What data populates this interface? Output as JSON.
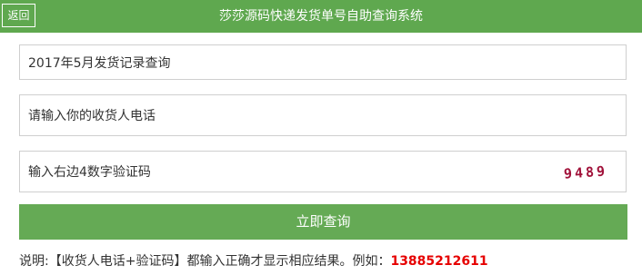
{
  "header": {
    "back_label": "返回",
    "title": "莎莎源码快递发货单号自助查询系统"
  },
  "form": {
    "query_period": "2017年5月发货记录查询",
    "phone_placeholder": "请输入你的收货人电话",
    "captcha_placeholder": "输入右边4数字验证码",
    "captcha_code": "9489",
    "submit_label": "立即查询"
  },
  "note": {
    "text": "说明:【收货人电话+验证码】都输入正确才显示相应结果。例如：",
    "example_phone": "13885212611"
  },
  "colors": {
    "header_bg": "#5fa84f",
    "button_bg": "#65aa55",
    "highlight": "#e60000"
  }
}
